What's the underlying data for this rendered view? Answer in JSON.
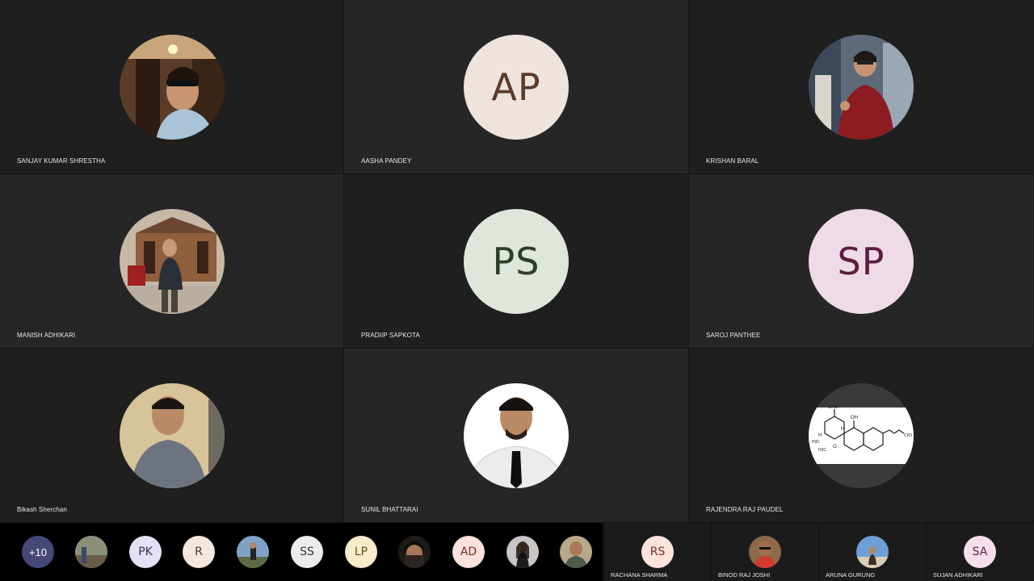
{
  "colors": {
    "ap_bg": "#eee4dd",
    "ap_fg": "#5b3b2c",
    "ps_bg": "#dfe6dc",
    "ps_fg": "#2e3d26",
    "sp_bg": "#efdbe7",
    "sp_fg": "#5a1e3d",
    "more_badge": "#474777"
  },
  "participants": [
    {
      "name": "SANJAY KUMAR SHRESTHA",
      "avatar": "photo-man-sunglasses"
    },
    {
      "name": "AASHA PANDEY",
      "initials": "AP"
    },
    {
      "name": "KRISHAN BARAL",
      "avatar": "photo-man-red-jacket"
    },
    {
      "name": "MANISH ADHIKARI",
      "avatar": "photo-man-temple"
    },
    {
      "name": "PRADIIP SAPKOTA",
      "initials": "PS"
    },
    {
      "name": "SAROJ PANTHEE",
      "initials": "SP"
    },
    {
      "name": "Bikash Sherchan",
      "avatar": "photo-man-grey-shirt"
    },
    {
      "name": "SUNIL BHATTARAI",
      "avatar": "photo-man-tie"
    },
    {
      "name": "RAJENDRA RAJ PAUDEL",
      "avatar": "molecule-structure"
    }
  ],
  "overflow": {
    "more_label": "+10",
    "avatars": [
      {
        "avatar": "photo-outdoor"
      },
      {
        "initials": "PK"
      },
      {
        "initials": "R"
      },
      {
        "avatar": "photo-person-field"
      },
      {
        "initials": "SS"
      },
      {
        "initials": "LP"
      },
      {
        "avatar": "photo-woman-scarf"
      },
      {
        "initials": "AD"
      },
      {
        "avatar": "photo-woman-dark"
      },
      {
        "avatar": "photo-man-portrait"
      }
    ]
  },
  "strip_participants": [
    {
      "name": "RACHANA SHARMA",
      "initials": "RS"
    },
    {
      "name": "BINOD RAJ JOSHI",
      "avatar": "photo-man-red-shirt"
    },
    {
      "name": "ARUNA GURUNG",
      "avatar": "photo-woman-sky"
    },
    {
      "name": "SUJAN ADHIKARI",
      "initials": "SA"
    }
  ],
  "molecule": {
    "labels": [
      "CH3",
      "OH",
      "H",
      "H",
      "H3C",
      "H3C",
      "O",
      "CH3"
    ]
  }
}
